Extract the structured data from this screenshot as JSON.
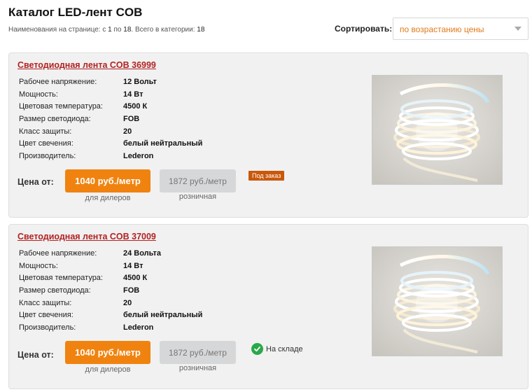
{
  "header": {
    "title": "Каталог LED-лент COB",
    "meta_prefix": "Наименования на странице: с",
    "meta_from": "1",
    "meta_by": "по",
    "meta_to": "18",
    "meta_total_label": ". Всего в категории:",
    "meta_total": "18"
  },
  "sort": {
    "label": "Сортировать:",
    "value": "по возрастанию цены"
  },
  "products": [
    {
      "title": "Светодиодная лента COB 36999",
      "specs": [
        {
          "k": "Рабочее напряжение:",
          "v": "12 Вольт"
        },
        {
          "k": "Мощность:",
          "v": "14 Вт"
        },
        {
          "k": "Цветовая температура:",
          "v": "4500 К"
        },
        {
          "k": "Размер светодиода:",
          "v": "FOB"
        },
        {
          "k": "Класс защиты:",
          "v": "20"
        },
        {
          "k": "Цвет свечения:",
          "v": "белый нейтральный"
        },
        {
          "k": "Производитель:",
          "v": "Lederon"
        }
      ],
      "price_label": "Цена от:",
      "dealer_price": "1040 руб./метр",
      "dealer_caption": "для дилеров",
      "retail_price": "1872 руб./метр",
      "retail_caption": "розничная",
      "availability": "Под заказ",
      "availability_type": "order"
    },
    {
      "title": "Светодиодная лента COB 37009",
      "specs": [
        {
          "k": "Рабочее напряжение:",
          "v": "24 Вольта"
        },
        {
          "k": "Мощность:",
          "v": "14 Вт"
        },
        {
          "k": "Цветовая температура:",
          "v": "4500 К"
        },
        {
          "k": "Размер светодиода:",
          "v": "FOB"
        },
        {
          "k": "Класс защиты:",
          "v": "20"
        },
        {
          "k": "Цвет свечения:",
          "v": "белый нейтральный"
        },
        {
          "k": "Производитель:",
          "v": "Lederon"
        }
      ],
      "price_label": "Цена от:",
      "dealer_price": "1040 руб./метр",
      "dealer_caption": "для дилеров",
      "retail_price": "1872 руб./метр",
      "retail_caption": "розничная",
      "availability": "На складе",
      "availability_type": "stock"
    }
  ],
  "colors": {
    "accent": "#f0830f",
    "title_link": "#b22222",
    "order_badge": "#c9580b",
    "in_stock": "#2aa84a"
  },
  "icons": {
    "sort_chevron": "chevron-down-icon",
    "in_stock": "check-circle-icon"
  }
}
